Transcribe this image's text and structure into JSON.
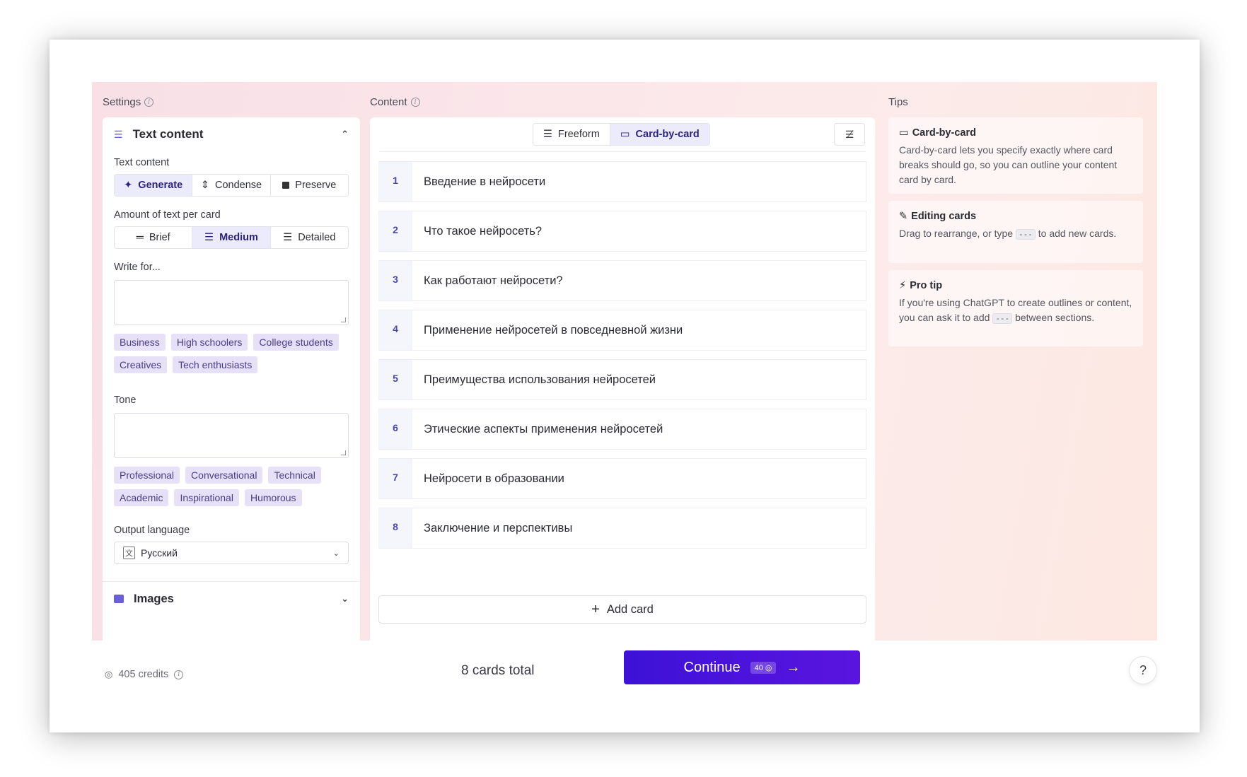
{
  "settings": {
    "label": "Settings",
    "text_content_header": "Text content",
    "text_content_label": "Text content",
    "text_modes": [
      "Generate",
      "Condense",
      "Preserve"
    ],
    "amount_label": "Amount of text per card",
    "amount_options": [
      "Brief",
      "Medium",
      "Detailed"
    ],
    "write_for_label": "Write for...",
    "audience_chips": [
      "Business",
      "High schoolers",
      "College students",
      "Creatives",
      "Tech enthusiasts"
    ],
    "tone_label": "Tone",
    "tone_chips": [
      "Professional",
      "Conversational",
      "Technical",
      "Academic",
      "Inspirational",
      "Humorous"
    ],
    "output_language_label": "Output language",
    "output_language_value": "Русский",
    "images_header": "Images"
  },
  "content": {
    "label": "Content",
    "toggle_freeform": "Freeform",
    "toggle_card": "Card-by-card",
    "cards": [
      {
        "num": "1",
        "title": "Введение в нейросети"
      },
      {
        "num": "2",
        "title": "Что такое нейросеть?"
      },
      {
        "num": "3",
        "title": "Как работают нейросети?"
      },
      {
        "num": "4",
        "title": "Применение нейросетей в повседневной жизни"
      },
      {
        "num": "5",
        "title": "Преимущества использования нейросетей"
      },
      {
        "num": "6",
        "title": "Этические аспекты применения нейросетей"
      },
      {
        "num": "7",
        "title": "Нейросети в образовании"
      },
      {
        "num": "8",
        "title": "Заключение и перспективы"
      }
    ],
    "add_card": "Add card"
  },
  "tips": {
    "label": "Tips",
    "items": [
      {
        "title": "Card-by-card",
        "body": "Card-by-card lets you specify exactly where card breaks should go, so you can outline your content card by card."
      },
      {
        "title": "Editing cards",
        "body_before": "Drag to rearrange, or type",
        "code": "---",
        "body_after": "to add new cards."
      },
      {
        "title": "Pro tip",
        "body_before": "If you're using ChatGPT to create outlines or content, you can ask it to add",
        "code": "---",
        "body_after": "between sections."
      }
    ]
  },
  "footer": {
    "credits": "405 credits",
    "cards_total": "8 cards total",
    "continue_label": "Continue",
    "continue_badge": "40",
    "help": "?"
  },
  "colors": {
    "accent": "#4a16dc",
    "chip_bg": "#e6e1f7",
    "active_seg": "#ecebfb"
  }
}
